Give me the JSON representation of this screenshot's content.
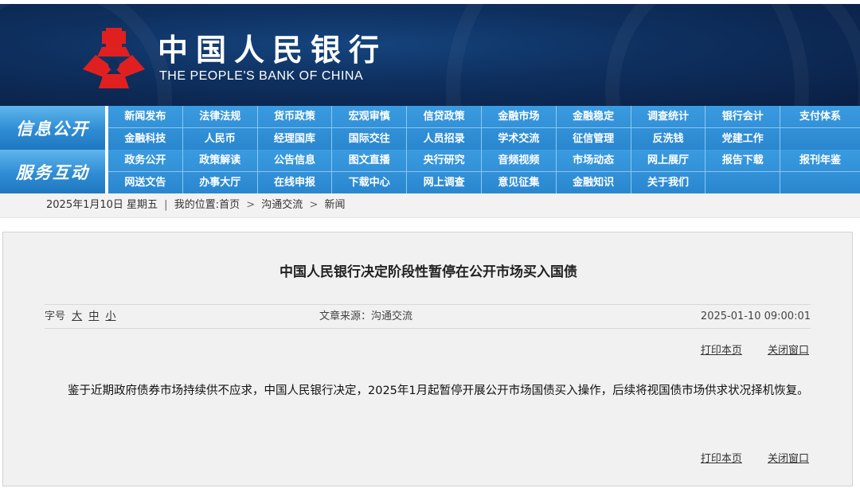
{
  "colors": {
    "banner_dark": "#0a1f44",
    "nav_blue": "#2a87cf",
    "nav_label_blue": "#2f8cd4",
    "logo_red": "#e02020"
  },
  "header": {
    "logo_icon": "pboc-emblem-icon",
    "title_cn": "中国人民银行",
    "title_en": "THE PEOPLE'S BANK OF CHINA"
  },
  "nav": {
    "group1": {
      "label": "信息公开",
      "row1": [
        "新闻发布",
        "法律法规",
        "货币政策",
        "宏观审慎",
        "信贷政策",
        "金融市场",
        "金融稳定",
        "调查统计",
        "银行会计",
        "支付体系"
      ],
      "row2": [
        "金融科技",
        "人民币",
        "经理国库",
        "国际交往",
        "人员招录",
        "学术交流",
        "征信管理",
        "反洗钱",
        "党建工作",
        ""
      ]
    },
    "group2": {
      "label": "服务互动",
      "row1": [
        "政务公开",
        "政策解读",
        "公告信息",
        "图文直播",
        "央行研究",
        "音频视频",
        "市场动态",
        "网上展厅",
        "报告下载",
        "报刊年鉴"
      ],
      "row2": [
        "网送文告",
        "办事大厅",
        "在线申报",
        "下载中心",
        "网上调查",
        "意见征集",
        "金融知识",
        "关于我们",
        "",
        ""
      ]
    }
  },
  "breadcrumb": {
    "date": "2025年1月10日 星期五",
    "location_label": "我的位置:",
    "home": "首页",
    "section": "沟通交流",
    "current": "新闻",
    "arrow": ">"
  },
  "article": {
    "title": "中国人民银行决定阶段性暂停在公开市场买入国债",
    "font_size_label": "字号",
    "font_sizes": [
      "大",
      "中",
      "小"
    ],
    "source": "文章来源：沟通交流",
    "date": "2025-01-10 09:00:01",
    "print_label": "打印本页",
    "close_label": "关闭窗口",
    "body": "鉴于近期政府债券市场持续供不应求，中国人民银行决定，2025年1月起暂停开展公开市场国债买入操作，后续将视国债市场供求状况择机恢复。"
  }
}
